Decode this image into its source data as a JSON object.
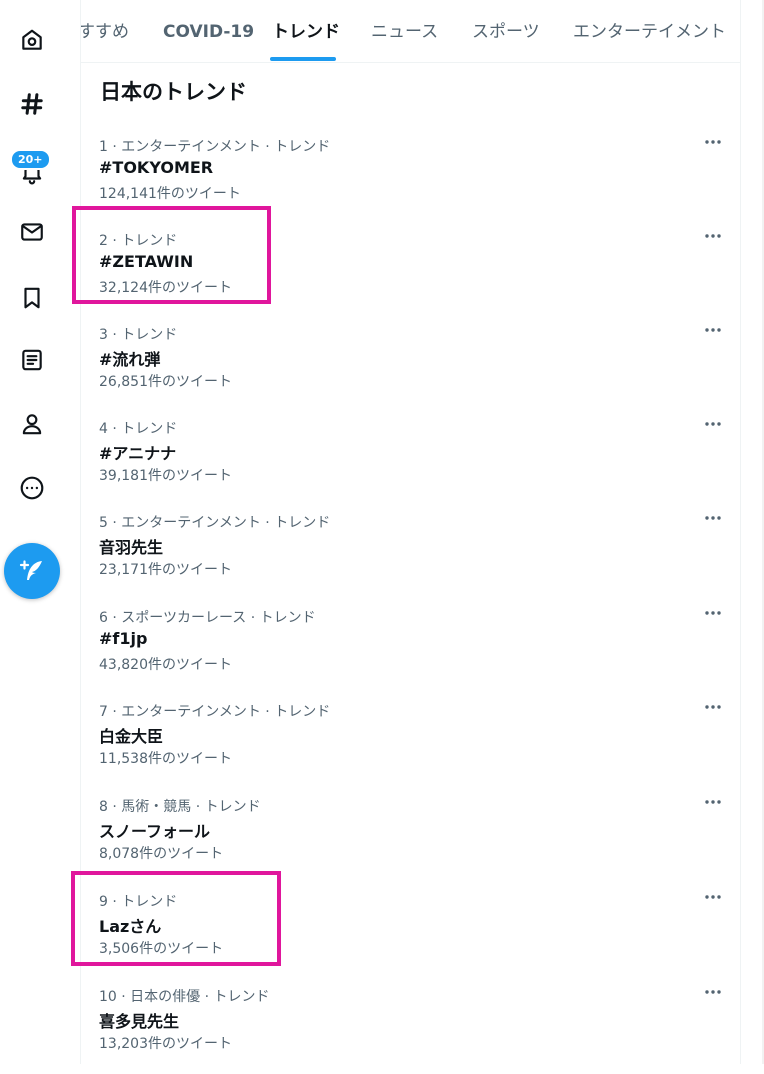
{
  "nav": {
    "notification_badge": "20+",
    "icons": [
      "home-icon",
      "explore-hashtag-icon",
      "notifications-bell-icon",
      "messages-envelope-icon",
      "bookmarks-icon",
      "lists-icon",
      "profile-icon",
      "more-circle-icon"
    ],
    "tweet_button_icon": "compose-feather-plus-icon"
  },
  "tabs": [
    {
      "label": "すすめ"
    },
    {
      "label": "COVID-19"
    },
    {
      "label": "トレンド",
      "active": true
    },
    {
      "label": "ニュース"
    },
    {
      "label": "スポーツ"
    },
    {
      "label": "エンターテイメント"
    }
  ],
  "section_title": "日本のトレンド",
  "trends": [
    {
      "meta": "1 · エンターテインメント · トレンド",
      "name": "#TOKYOMER",
      "count": "124,141件のツイート"
    },
    {
      "meta": "2 · トレンド",
      "name": "#ZETAWIN",
      "count": "32,124件のツイート"
    },
    {
      "meta": "3 · トレンド",
      "name": "#流れ弾",
      "count": "26,851件のツイート"
    },
    {
      "meta": "4 · トレンド",
      "name": "#アニナナ",
      "count": "39,181件のツイート"
    },
    {
      "meta": "5 · エンターテインメント · トレンド",
      "name": "音羽先生",
      "count": "23,171件のツイート"
    },
    {
      "meta": "6 · スポーツカーレース · トレンド",
      "name": "#f1jp",
      "count": "43,820件のツイート"
    },
    {
      "meta": "7 · エンターテインメント · トレンド",
      "name": "白金大臣",
      "count": "11,538件のツイート"
    },
    {
      "meta": "8 · 馬術・競馬 · トレンド",
      "name": "スノーフォール",
      "count": "8,078件のツイート"
    },
    {
      "meta": "9 · トレンド",
      "name": "Lazさん",
      "count": "3,506件のツイート"
    },
    {
      "meta": "10 · 日本の俳優 · トレンド",
      "name": "喜多見先生",
      "count": "13,203件のツイート"
    }
  ],
  "highlight_color": "#e0169c",
  "accent_color": "#1d9bf0"
}
